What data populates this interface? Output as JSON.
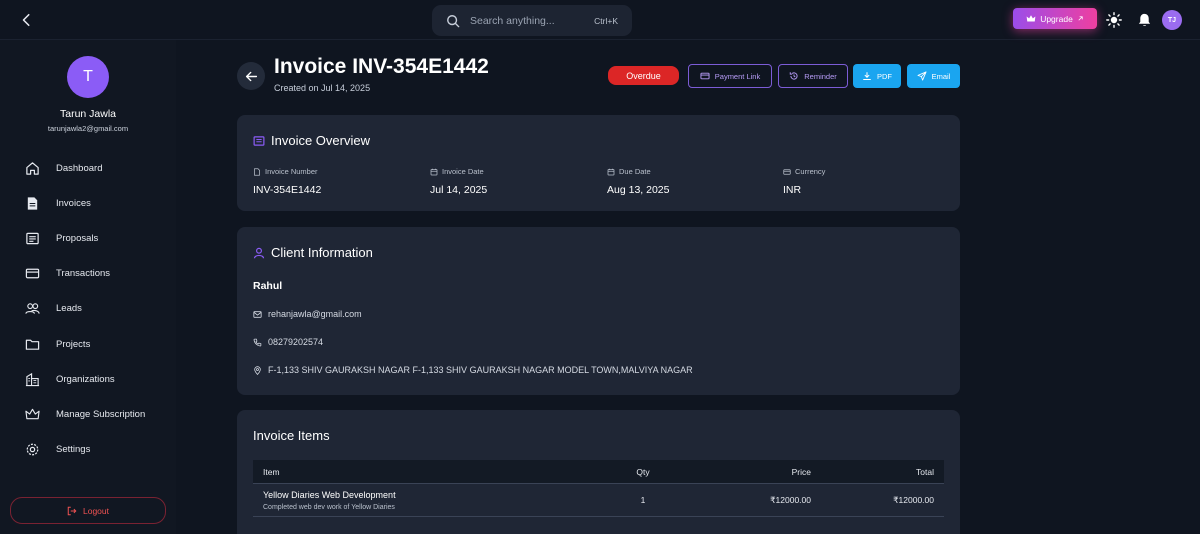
{
  "topbar": {
    "search_placeholder": "Search anything...",
    "search_shortcut": "Ctrl+K",
    "upgrade_label": "Upgrade",
    "avatar_initials": "TJ"
  },
  "sidebar": {
    "avatar_initial": "T",
    "user_name": "Tarun Jawla",
    "user_email": "tarunjawla2@gmail.com",
    "items": [
      {
        "label": "Dashboard",
        "icon": "home-icon"
      },
      {
        "label": "Invoices",
        "icon": "document-icon"
      },
      {
        "label": "Proposals",
        "icon": "list-icon"
      },
      {
        "label": "Transactions",
        "icon": "credit-card-icon"
      },
      {
        "label": "Leads",
        "icon": "users-icon"
      },
      {
        "label": "Projects",
        "icon": "folder-icon"
      },
      {
        "label": "Organizations",
        "icon": "building-icon"
      },
      {
        "label": "Manage Subscription",
        "icon": "crown-icon"
      },
      {
        "label": "Settings",
        "icon": "gear-icon"
      }
    ],
    "logout_label": "Logout"
  },
  "header": {
    "title": "Invoice INV-354E1442",
    "subtitle": "Created on Jul 14, 2025",
    "status": "Overdue",
    "buttons": {
      "payment_link": "Payment Link",
      "reminder": "Reminder",
      "pdf": "PDF",
      "email": "Email"
    }
  },
  "overview": {
    "title": "Invoice Overview",
    "fields": [
      {
        "label": "Invoice Number",
        "value": "INV-354E1442"
      },
      {
        "label": "Invoice Date",
        "value": "Jul 14, 2025"
      },
      {
        "label": "Due Date",
        "value": "Aug 13, 2025"
      },
      {
        "label": "Currency",
        "value": "INR"
      }
    ]
  },
  "client": {
    "title": "Client Information",
    "name": "Rahul",
    "email": "rehanjawla@gmail.com",
    "phone": "08279202574",
    "address": "F-1,133 SHIV GAURAKSH NAGAR F-1,133 SHIV GAURAKSH NAGAR MODEL TOWN,MALVIYA NAGAR"
  },
  "items": {
    "title": "Invoice Items",
    "columns": [
      "Item",
      "Qty",
      "Price",
      "Total"
    ],
    "rows": [
      {
        "name": "Yellow Diaries Web Development",
        "description": "Completed web dev work of Yellow Diaries",
        "qty": "1",
        "price": "₹12000.00",
        "total": "₹12000.00"
      }
    ]
  },
  "colors": {
    "background": "#0f1520",
    "card": "#1f2635",
    "accent_purple": "#8b5cf6",
    "status_red": "#dc2626",
    "button_blue": "#1aa5f0"
  }
}
